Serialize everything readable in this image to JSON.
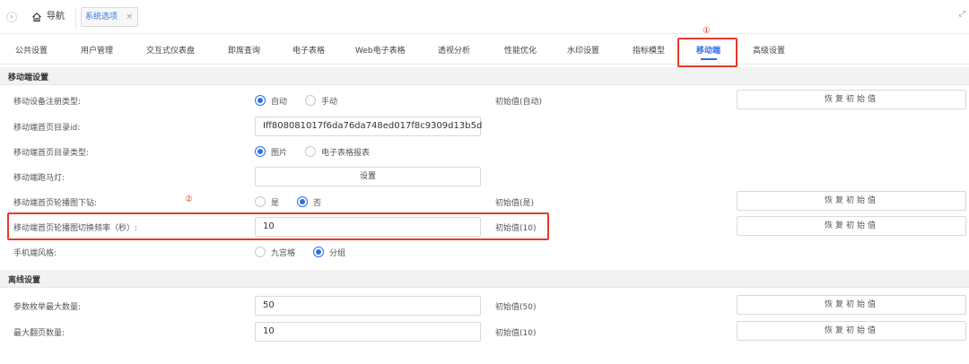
{
  "topbar": {
    "collapse_glyph": "›",
    "nav_label": "导航",
    "tab_chip": "系统选项",
    "tab_close": "×",
    "expand_glyph": "⤢"
  },
  "tabs": [
    "公共设置",
    "用户管理",
    "交互式仪表盘",
    "即席查询",
    "电子表格",
    "Web电子表格",
    "透视分析",
    "性能优化",
    "水印设置",
    "指标模型",
    "移动端",
    "高级设置"
  ],
  "active_tab": "移动端",
  "annotations": {
    "marker1": "①",
    "marker2": "②"
  },
  "accent_color": "#2f6fe4",
  "annotation_color": "#e53a2b",
  "mobile_section": {
    "title": "移动端设置",
    "registration_type": {
      "label": "移动设备注册类型:",
      "options": [
        "自动",
        "手动"
      ],
      "selected": "自动",
      "initial": "初始值(自动)",
      "restore": "恢复初始值"
    },
    "home_dir_id": {
      "label": "移动端首页目录id:",
      "value": "Iff808081017f6da76da748ed017f8c9309d13b5d"
    },
    "home_dir_type": {
      "label": "移动端首页目录类型:",
      "options": [
        "图片",
        "电子表格报表"
      ],
      "selected": "图片"
    },
    "marquee": {
      "label": "移动端跑马灯:",
      "button": "设置"
    },
    "carousel_pulldown": {
      "label": "移动端首页轮播图下钻:",
      "options": [
        "是",
        "否"
      ],
      "selected": "否",
      "initial": "初始值(是)",
      "restore": "恢复初始值"
    },
    "carousel_interval": {
      "label": "移动端首页轮播图切换频率（秒）:",
      "value": "10",
      "initial": "初始值(10)",
      "restore": "恢复初始值"
    },
    "phone_style": {
      "label": "手机端风格:",
      "options": [
        "九宫格",
        "分组"
      ],
      "selected": "分组"
    }
  },
  "offline_section": {
    "title": "离线设置",
    "param_max": {
      "label": "参数枚举最大数量:",
      "value": "50",
      "initial": "初始值(50)",
      "restore": "恢复初始值"
    },
    "max_pages": {
      "label": "最大翻页数量:",
      "value": "10",
      "initial": "初始值(10)",
      "restore": "恢复初始值"
    }
  }
}
